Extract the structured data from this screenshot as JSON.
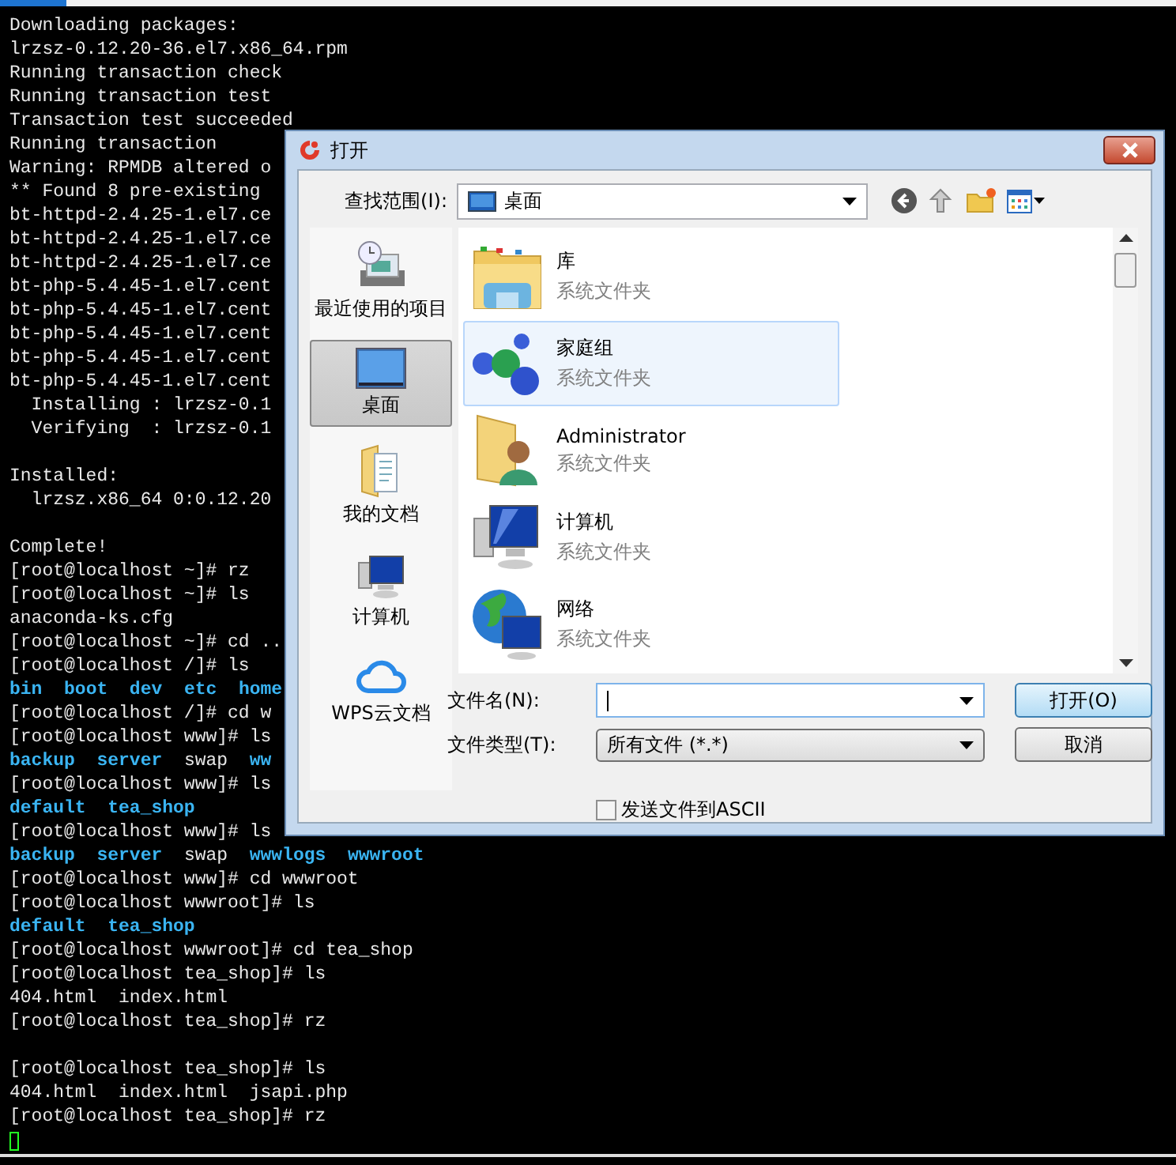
{
  "terminal": {
    "lines": [
      {
        "kind": "plain",
        "text": "Downloading packages:"
      },
      {
        "kind": "plain",
        "text": "lrzsz-0.12.20-36.el7.x86_64.rpm"
      },
      {
        "kind": "plain",
        "text": "Running transaction check"
      },
      {
        "kind": "plain",
        "text": "Running transaction test"
      },
      {
        "kind": "plain",
        "text": "Transaction test succeeded"
      },
      {
        "kind": "plain",
        "text": "Running transaction"
      },
      {
        "kind": "plain",
        "text": "Warning: RPMDB altered o"
      },
      {
        "kind": "plain",
        "text": "** Found 8 pre-existing"
      },
      {
        "kind": "plain",
        "text": "bt-httpd-2.4.25-1.el7.ce"
      },
      {
        "kind": "plain",
        "text": "bt-httpd-2.4.25-1.el7.ce"
      },
      {
        "kind": "plain",
        "text": "bt-httpd-2.4.25-1.el7.ce"
      },
      {
        "kind": "plain",
        "text": "bt-php-5.4.45-1.el7.cent"
      },
      {
        "kind": "plain",
        "text": "bt-php-5.4.45-1.el7.cent"
      },
      {
        "kind": "plain",
        "text": "bt-php-5.4.45-1.el7.cent"
      },
      {
        "kind": "plain",
        "text": "bt-php-5.4.45-1.el7.cent"
      },
      {
        "kind": "plain",
        "text": "bt-php-5.4.45-1.el7.cent"
      },
      {
        "kind": "plain",
        "text": "  Installing : lrzsz-0.1"
      },
      {
        "kind": "plain",
        "text": "  Verifying  : lrzsz-0.1"
      },
      {
        "kind": "blank"
      },
      {
        "kind": "plain",
        "text": "Installed:"
      },
      {
        "kind": "plain",
        "text": "  lrzsz.x86_64 0:0.12.20"
      },
      {
        "kind": "blank"
      },
      {
        "kind": "plain",
        "text": "Complete!"
      },
      {
        "kind": "plain",
        "text": "[root@localhost ~]# rz"
      },
      {
        "kind": "plain",
        "text": "[root@localhost ~]# ls"
      },
      {
        "kind": "plain",
        "text": "anaconda-ks.cfg"
      },
      {
        "kind": "plain",
        "text": "[root@localhost ~]# cd .."
      },
      {
        "kind": "plain",
        "text": "[root@localhost /]# ls"
      },
      {
        "kind": "listing",
        "items": [
          {
            "text": "bin",
            "kind": "dir"
          },
          {
            "text": "boot",
            "kind": "dir"
          },
          {
            "text": "dev",
            "kind": "dir"
          },
          {
            "text": "etc",
            "kind": "dir"
          },
          {
            "text": "home",
            "kind": "dir"
          }
        ]
      },
      {
        "kind": "plain",
        "text": "[root@localhost /]# cd w"
      },
      {
        "kind": "plain",
        "text": "[root@localhost www]# ls"
      },
      {
        "kind": "listing",
        "items": [
          {
            "text": "backup",
            "kind": "dir"
          },
          {
            "text": "server",
            "kind": "dir"
          },
          {
            "text": "swap",
            "kind": "file"
          },
          {
            "text": "ww",
            "kind": "dir"
          }
        ]
      },
      {
        "kind": "plain",
        "text": "[root@localhost www]# ls"
      },
      {
        "kind": "listing",
        "items": [
          {
            "text": "default",
            "kind": "dir"
          },
          {
            "text": "tea_shop",
            "kind": "dir"
          }
        ]
      },
      {
        "kind": "plain",
        "text": "[root@localhost www]# ls"
      },
      {
        "kind": "listing",
        "items": [
          {
            "text": "backup",
            "kind": "dir"
          },
          {
            "text": "server",
            "kind": "dir"
          },
          {
            "text": "swap",
            "kind": "file"
          },
          {
            "text": "wwwlogs",
            "kind": "dir"
          },
          {
            "text": "wwwroot",
            "kind": "dir"
          }
        ]
      },
      {
        "kind": "plain",
        "text": "[root@localhost www]# cd wwwroot"
      },
      {
        "kind": "plain",
        "text": "[root@localhost wwwroot]# ls"
      },
      {
        "kind": "listing",
        "items": [
          {
            "text": "default",
            "kind": "dir"
          },
          {
            "text": "tea_shop",
            "kind": "dir"
          }
        ]
      },
      {
        "kind": "plain",
        "text": "[root@localhost wwwroot]# cd tea_shop"
      },
      {
        "kind": "plain",
        "text": "[root@localhost tea_shop]# ls"
      },
      {
        "kind": "listing",
        "items": [
          {
            "text": "404.html",
            "kind": "file"
          },
          {
            "text": "index.html",
            "kind": "file"
          }
        ]
      },
      {
        "kind": "plain",
        "text": "[root@localhost tea_shop]# rz"
      },
      {
        "kind": "blank"
      },
      {
        "kind": "plain",
        "text": "[root@localhost tea_shop]# ls"
      },
      {
        "kind": "listing",
        "items": [
          {
            "text": "404.html",
            "kind": "file"
          },
          {
            "text": "index.html",
            "kind": "file"
          },
          {
            "text": "jsapi.php",
            "kind": "file"
          }
        ]
      },
      {
        "kind": "plain",
        "text": "[root@localhost tea_shop]# rz"
      },
      {
        "kind": "cursor"
      }
    ]
  },
  "dialog": {
    "title": "打开",
    "look_in": {
      "label": "查找范围(I):",
      "value": "桌面"
    },
    "places": [
      {
        "label": "最近使用的项目",
        "kind": "recent",
        "selected": false
      },
      {
        "label": "桌面",
        "kind": "desktop",
        "selected": true
      },
      {
        "label": "我的文档",
        "kind": "documents",
        "selected": false
      },
      {
        "label": "计算机",
        "kind": "computer",
        "selected": false
      },
      {
        "label": "WPS云文档",
        "kind": "cloud",
        "selected": false
      }
    ],
    "files": [
      {
        "name": "库",
        "type": "系统文件夹",
        "kind": "library",
        "selected": false
      },
      {
        "name": "家庭组",
        "type": "系统文件夹",
        "kind": "homegroup",
        "selected": true
      },
      {
        "name": "Administrator",
        "type": "系统文件夹",
        "kind": "user",
        "selected": false
      },
      {
        "name": "计算机",
        "type": "系统文件夹",
        "kind": "computer",
        "selected": false
      },
      {
        "name": "网络",
        "type": "系统文件夹",
        "kind": "network",
        "selected": false
      }
    ],
    "file_name": {
      "label": "文件名(N):"
    },
    "file_type": {
      "label": "文件类型(T):",
      "value": "所有文件 (*.*)"
    },
    "buttons": [
      {
        "label": "打开(O)",
        "default": true
      },
      {
        "label": "取消",
        "default": false
      }
    ],
    "ascii": {
      "label": "发送文件到ASCII",
      "checked": false
    }
  }
}
